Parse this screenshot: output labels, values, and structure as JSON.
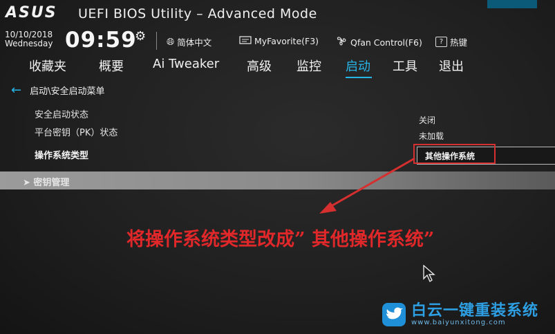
{
  "header": {
    "brand": "ASUS",
    "title": "UEFI BIOS Utility – Advanced Mode"
  },
  "status": {
    "date": "10/10/2018",
    "weekday": "Wednesday",
    "time": "09:59",
    "language": "简体中文",
    "favorite": "MyFavorite(F3)",
    "qfan": "Qfan Control(F6)",
    "hotkeys": "热键"
  },
  "menu": {
    "items": [
      "收藏夹",
      "概要",
      "Ai Tweaker",
      "高级",
      "监控",
      "启动",
      "工具",
      "退出"
    ],
    "active": "启动"
  },
  "breadcrumb": "启动\\安全启动菜单",
  "settings": {
    "secure_boot_state_label": "安全启动状态",
    "secure_boot_state_value": "关闭",
    "platform_key_label": "平台密钥（PK）状态",
    "platform_key_value": "未加载",
    "os_type_label": "操作系统类型",
    "os_type_value": "其他操作系统"
  },
  "section": {
    "key_management": "密钥管理"
  },
  "annotation": "将操作系统类型改成” 其他操作系统”",
  "watermark": {
    "title": "白云一键重装系统",
    "url": "www.baiyunxitong.com"
  },
  "colors": {
    "accent": "#26b6e8",
    "annotation_red": "#e0282a",
    "watermark_blue": "#2d9fe2"
  }
}
